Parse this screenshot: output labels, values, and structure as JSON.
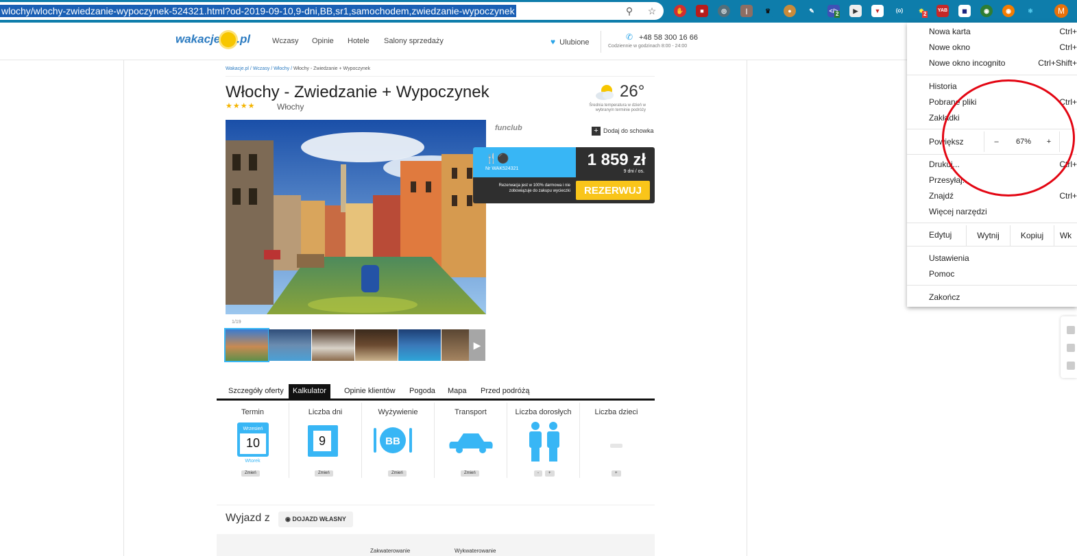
{
  "browser": {
    "url": "wlochy/wlochy-zwiedzanie-wypoczynek-524321.html?od-2019-09-10,9-dni,BB,sr1,samochodem,zwiedzanie-wypoczynek",
    "profile_initial": "M",
    "ext_badge_1": "2",
    "ext_badge_2": "2",
    "ext_yab": "YAB",
    "ext_ow": "(o)"
  },
  "header": {
    "logo_left": "wakacje",
    "logo_right": ".pl",
    "nav": [
      "Wczasy",
      "Opinie",
      "Hotele",
      "Salony sprzedaży"
    ],
    "favorites": "Ulubione",
    "phone": "+48 58 300 16 66",
    "phone_hours": "Codziennie w godzinach 8:00 - 24:00"
  },
  "breadcrumb": {
    "items": [
      "Wakacje.pl",
      "Wczasy",
      "Włochy"
    ],
    "current": "Włochy - Zwiedzanie + Wypoczynek"
  },
  "offer": {
    "title": "Włochy - Zwiedzanie + Wypoczynek",
    "rating_stars": 4,
    "stars_text": "★★★★",
    "country": "Włochy",
    "temperature": "26°",
    "temperature_note": "Średnia temperatura w dzień w wybranym terminie podróży",
    "photo_counter": "1/19",
    "partner": "funclub",
    "add_to_clipboard": "Dodaj do schowka",
    "offer_nr": "Nr WAK524321",
    "price": "1 859 zł",
    "price_unit": "9 dni / os.",
    "reservation_note": "Rezerwacja jest w 100% darmowa i nie zobowiązuje do zakupu wycieczki",
    "reserve_button": "REZERWUJ"
  },
  "tabs": [
    "Szczegóły oferty",
    "Kalkulator",
    "Opinie klientów",
    "Pogoda",
    "Mapa",
    "Przed podróżą"
  ],
  "active_tab": "Kalkulator",
  "calculator": {
    "term_label": "Termin",
    "term_month": "Wrzesień",
    "term_day": "10",
    "term_weekday": "Wtorek",
    "days_label": "Liczba dni",
    "days_value": "9",
    "board_label": "Wyżywienie",
    "board_value": "BB",
    "transport_label": "Transport",
    "adults_label": "Liczba dorosłych",
    "children_label": "Liczba dzieci",
    "change": "Zmień",
    "minus": "-",
    "plus": "+"
  },
  "departure": {
    "label": "Wyjazd z",
    "option": "DOJAZD WŁASNY",
    "col_1": "Zakwaterowanie",
    "col_2": "Wykwaterowanie"
  },
  "menu": {
    "new_tab": "Nowa karta",
    "new_tab_sc": "Ctrl+",
    "new_window": "Nowe okno",
    "new_window_sc": "Ctrl+",
    "incognito": "Nowe okno incognito",
    "incognito_sc": "Ctrl+Shift+",
    "history": "Historia",
    "downloads": "Pobrane pliki",
    "downloads_sc": "Ctrl+",
    "bookmarks": "Zakładki",
    "zoom_label": "Powiększ",
    "zoom_minus": "–",
    "zoom_value": "67%",
    "zoom_plus": "+",
    "print": "Drukuj...",
    "print_sc": "Ctrl+",
    "cast": "Przesyłaj...",
    "find": "Znajdź",
    "find_sc": "Ctrl+",
    "more_tools": "Więcej narzędzi",
    "edit": "Edytuj",
    "cut": "Wytnij",
    "copy": "Kopiuj",
    "paste": "Wk",
    "settings": "Ustawienia",
    "help": "Pomoc",
    "exit": "Zakończ"
  },
  "colors": {
    "accent_blue": "#38b6f5",
    "reserve_yellow": "#f9c51a",
    "chrome_bar": "#0e7dab",
    "annotation_red": "#e30613"
  }
}
